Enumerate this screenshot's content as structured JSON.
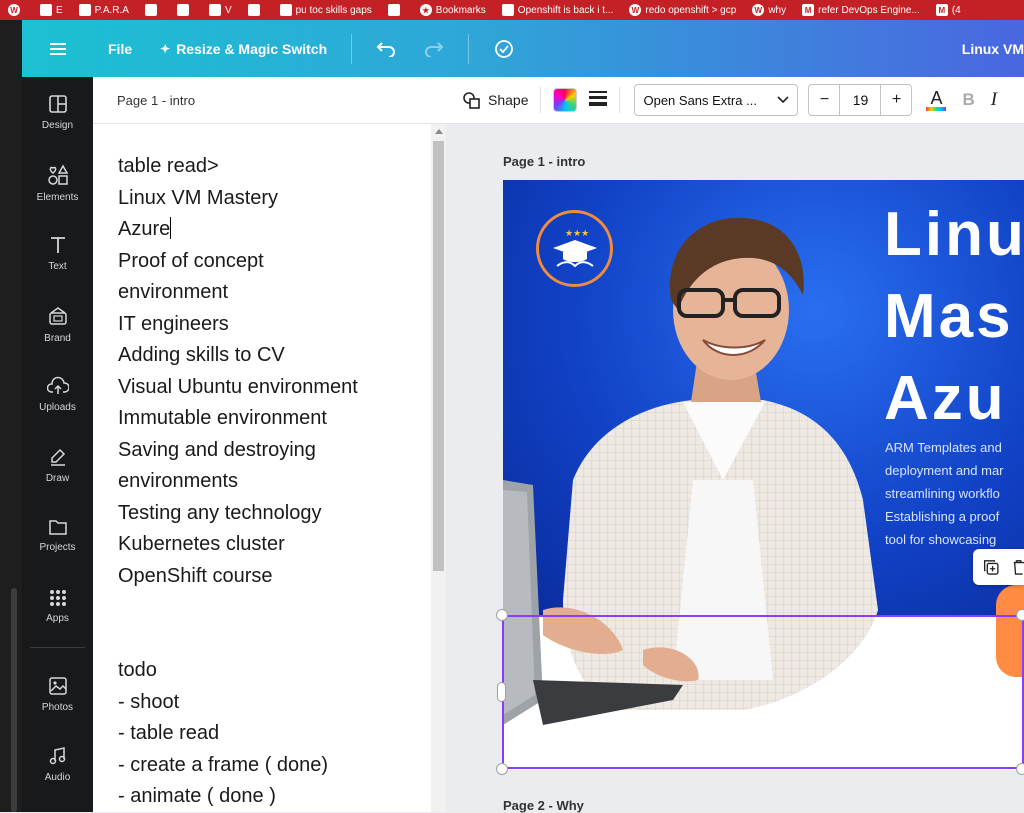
{
  "bookmarks": [
    {
      "icon": "wordpress-icon",
      "label": ""
    },
    {
      "icon": "bookmark-icon",
      "label": "E"
    },
    {
      "icon": "folder-icon",
      "label": "P.A.R.A"
    },
    {
      "icon": "bookmark-icon",
      "label": ""
    },
    {
      "icon": "bookmark-icon",
      "label": ""
    },
    {
      "icon": "bookmark-icon",
      "label": "V"
    },
    {
      "icon": "bookmark-icon",
      "label": ""
    },
    {
      "icon": "bookmark-icon",
      "label": "pu toc skills gaps"
    },
    {
      "icon": "bookmark-icon",
      "label": ""
    },
    {
      "icon": "star-icon",
      "label": "Bookmarks"
    },
    {
      "icon": "bookmark-icon",
      "label": "Openshift is back i t..."
    },
    {
      "icon": "wordpress-icon",
      "label": "redo openshift > gcp"
    },
    {
      "icon": "wordpress-icon",
      "label": "why"
    },
    {
      "icon": "gmail-icon",
      "label": "refer DevOps Engine..."
    },
    {
      "icon": "gmail-icon",
      "label": "(4"
    }
  ],
  "topbar": {
    "file_label": "File",
    "resize_label": "Resize & Magic Switch",
    "title": "Linux VM"
  },
  "rail": [
    {
      "label": "Design",
      "icon": "design-icon"
    },
    {
      "label": "Elements",
      "icon": "elements-icon"
    },
    {
      "label": "Text",
      "icon": "text-icon"
    },
    {
      "label": "Brand",
      "icon": "brand-icon"
    },
    {
      "label": "Uploads",
      "icon": "uploads-icon"
    },
    {
      "label": "Draw",
      "icon": "draw-icon"
    },
    {
      "label": "Projects",
      "icon": "projects-icon"
    },
    {
      "label": "Apps",
      "icon": "apps-icon"
    },
    {
      "label": "Photos",
      "icon": "photos-icon"
    },
    {
      "label": "Audio",
      "icon": "audio-icon"
    }
  ],
  "notes": {
    "header": "Page 1 - intro",
    "lines": [
      "table read>",
      "Linux VM Mastery",
      "Azure",
      "Proof of concept",
      "environment",
      "IT engineers",
      "Adding skills to CV",
      "Visual Ubuntu environment",
      "Immutable environment",
      "Saving and destroying",
      "environments",
      "Testing any technology",
      "Kubernetes cluster",
      "OpenShift course",
      "",
      "",
      "todo",
      "- shoot",
      "- table read",
      "- create a frame ( done)",
      "- animate ( done )"
    ]
  },
  "element_toolbar": {
    "shape_label": "Shape",
    "font_name": "Open Sans Extra ...",
    "font_size": "19",
    "minus": "−",
    "plus": "+",
    "bold": "B",
    "italic": "I",
    "text_color_letter": "A"
  },
  "canvas": {
    "page1_label": "Page 1 - intro",
    "page2_label": "Page 2 - Why",
    "headline": [
      "Linu",
      "Mas",
      "Azu"
    ],
    "description": [
      "ARM Templates and",
      "deployment and mar",
      "streamlining workflo",
      "Establishing a proof",
      "tool for showcasing"
    ]
  },
  "colors": {
    "accent": "#8b3dff",
    "bookmark_bar": "#c42127",
    "topbar_start": "#1bc1d2",
    "topbar_end": "#4a66e0",
    "design_blue": "#1142c6",
    "logo_orange": "#f08c3c"
  }
}
